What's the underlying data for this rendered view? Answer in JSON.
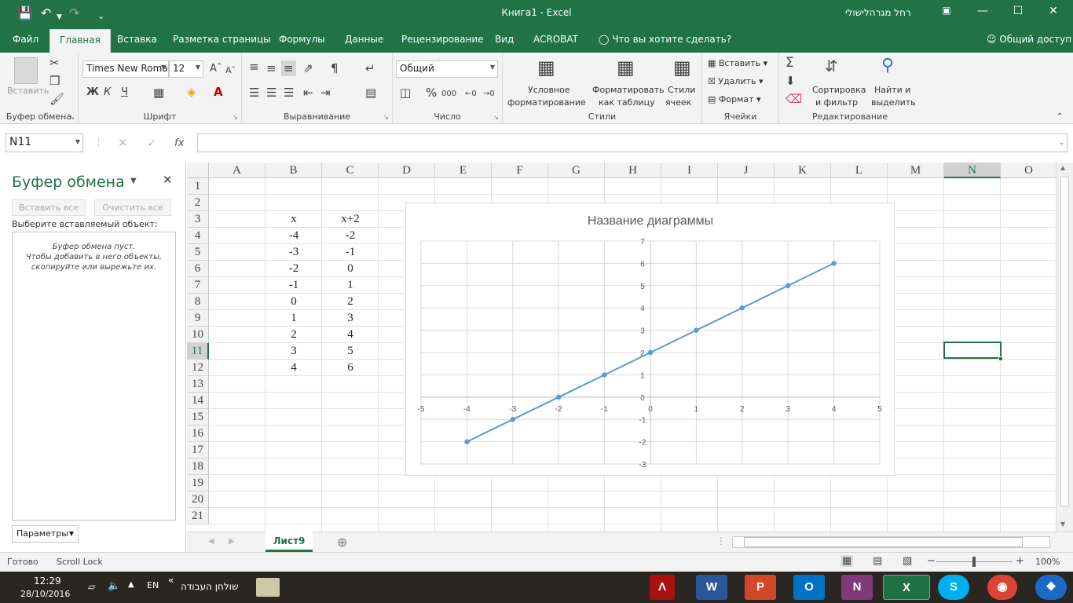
{
  "window": {
    "title": "Книга1  -  Excel",
    "user": "רחל מגרהלישולי"
  },
  "menu": {
    "tabs": [
      "Файл",
      "Главная",
      "Вставка",
      "Разметка страницы",
      "Формулы",
      "Данные",
      "Рецензирование",
      "Вид",
      "ACROBAT"
    ],
    "tellme": "Что вы хотите сделать?",
    "share": "Общий доступ"
  },
  "ribbon": {
    "clipboard": {
      "label": "Буфер обмена",
      "paste": "Вставить"
    },
    "font": {
      "label": "Шрифт",
      "name": "Times New Roma",
      "size": "12",
      "bold": "Ж",
      "italic": "К",
      "underline": "Ч"
    },
    "alignment": {
      "label": "Выравнивание"
    },
    "number": {
      "label": "Число",
      "format": "Общий"
    },
    "styles": {
      "label": "Стили",
      "conditional": [
        "Условное",
        "форматирование"
      ],
      "as_table": [
        "Форматировать",
        "как таблицу"
      ],
      "cell_styles": [
        "Стили",
        "ячеек"
      ]
    },
    "cells": {
      "label": "Ячейки",
      "insert": "Вставить",
      "delete": "Удалить",
      "format": "Формат"
    },
    "editing": {
      "label": "Редактирование",
      "sort": [
        "Сортировка",
        "и фильтр"
      ],
      "find": [
        "Найти и",
        "выделить"
      ]
    }
  },
  "formula_bar": {
    "name_box": "N11",
    "fx": "fx",
    "value": ""
  },
  "clipboard_pane": {
    "title": "Буфер обмена",
    "paste_all": "Вставить все",
    "clear_all": "Очистить все",
    "prompt": "Выберите вставляемый объект:",
    "empty": [
      "Буфер обмена пуст.",
      "Чтобы добавить в него объекты,",
      "скопируйте или вырежьте их."
    ],
    "options": "Параметры"
  },
  "sheet": {
    "columns": [
      "A",
      "B",
      "C",
      "D",
      "E",
      "F",
      "G",
      "H",
      "I",
      "J",
      "K",
      "L",
      "M",
      "N",
      "O"
    ],
    "rows": [
      "1",
      "2",
      "3",
      "4",
      "5",
      "6",
      "7",
      "8",
      "9",
      "10",
      "11",
      "12",
      "13",
      "14",
      "15",
      "16",
      "17",
      "18",
      "19",
      "20",
      "21"
    ],
    "active_column": "N",
    "active_row": "11",
    "table": [
      [
        "x",
        "x+2"
      ],
      [
        "-4",
        "-2"
      ],
      [
        "-3",
        "-1"
      ],
      [
        "-2",
        "0"
      ],
      [
        "-1",
        "1"
      ],
      [
        "0",
        "2"
      ],
      [
        "1",
        "3"
      ],
      [
        "2",
        "4"
      ],
      [
        "3",
        "5"
      ],
      [
        "4",
        "6"
      ]
    ],
    "tab": "Лист9"
  },
  "chart_data": {
    "type": "scatter",
    "title": "Название диаграммы",
    "x": [
      -4,
      -3,
      -2,
      -1,
      0,
      1,
      2,
      3,
      4
    ],
    "y": [
      -2,
      -1,
      0,
      1,
      2,
      3,
      4,
      5,
      6
    ],
    "xlim": [
      -5,
      5
    ],
    "ylim": [
      -3,
      7
    ],
    "xticks": [
      "-5",
      "-4",
      "-3",
      "-2",
      "-1",
      "0",
      "1",
      "2",
      "3",
      "4",
      "5"
    ],
    "yticks": [
      "-3",
      "-2",
      "-1",
      "0",
      "1",
      "2",
      "3",
      "4",
      "5",
      "6",
      "7"
    ],
    "grid": true,
    "line_color": "#5b9bd5"
  },
  "status": {
    "ready": "Готово",
    "scroll_lock": "Scroll Lock",
    "zoom": "100%"
  },
  "taskbar": {
    "time": "12:29",
    "date": "28/10/2016",
    "lang": "EN",
    "desktop": "שולחן העבודה"
  },
  "colors": {
    "accent": "#217346",
    "selection": "#217346"
  }
}
